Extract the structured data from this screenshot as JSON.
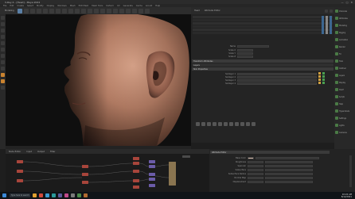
{
  "window": {
    "title": "V-Ray 4 - [Head] - Maya 2022",
    "controls": [
      "—",
      "□",
      "✕"
    ]
  },
  "menu": [
    "File",
    "Edit",
    "Create",
    "Select",
    "Modify",
    "Display",
    "Windows",
    "Mesh",
    "Edit Mesh",
    "Mesh Tools",
    "Deform",
    "UV",
    "Generate",
    "Cache",
    "Arnold",
    "Help"
  ],
  "toolbar": {
    "mode_label": "Modeling"
  },
  "right_panel": {
    "header_tabs": [
      "Head",
      "Attribute Editor"
    ],
    "props": [
      {
        "label": "Name"
      },
      {
        "label": "Scale X"
      },
      {
        "label": "Scale Y"
      },
      {
        "label": "Scale Z"
      }
    ],
    "sections": [
      "Transform Attributes",
      "Layers",
      "Skin Properties"
    ],
    "sub_rows": [
      "Sublayer 1",
      "Sublayer 2",
      "Sublayer 3",
      "Sublayer 4"
    ]
  },
  "dock": {
    "items": [
      "Channels",
      "Attributes",
      "Modeling",
      "Rigging",
      "Animation",
      "Render",
      "FX",
      "Tools",
      "Outliner",
      "Layers",
      "Display",
      "Shelf",
      "Scripts",
      "Help",
      "Hypershade",
      "Settings",
      "Lights",
      "Cameras"
    ]
  },
  "node_editor": {
    "tabs": [
      "Node Editor",
      "Input",
      "Output",
      "Filter"
    ]
  },
  "bottom_attr": {
    "title": "Attribute Editor",
    "rows": [
      "Base Color",
      "Roughness",
      "Specular",
      "Subsurface",
      "Subsurface Radius",
      "Normal Map",
      "Displacement"
    ]
  },
  "taskbar": {
    "search_placeholder": "Type here to search",
    "time": "10:24 AM",
    "date": "8/12/2021"
  },
  "colors": {
    "accent_blue": "#5a7fa6",
    "tool_orange": "#c9822f",
    "dock_green": "#4a7a45",
    "node_red": "#a8453b",
    "node_purple": "#6b5ca8",
    "node_tan": "#8a7550"
  }
}
